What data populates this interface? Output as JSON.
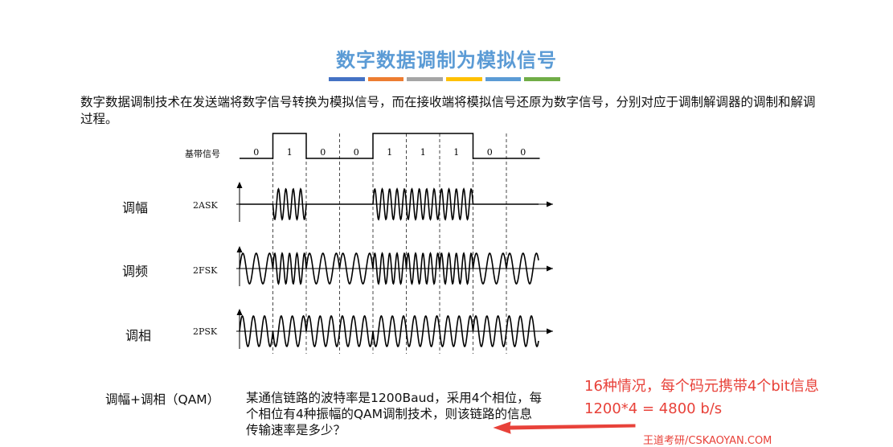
{
  "title": "数字数据调制为模拟信号",
  "title_bar_colors": [
    "#4472c4",
    "#ed7d31",
    "#a5a5a5",
    "#ffc000",
    "#5b9bd5",
    "#70ad47"
  ],
  "intro": "数字数据调制技术在发送端将数字信号转换为模拟信号，而在接收端将模拟信号还原为数字信号，分别对应于调制解调器的调制和解调过程。",
  "diagram": {
    "baseband_label": "基带信号",
    "bits": [
      "0",
      "1",
      "0",
      "0",
      "1",
      "1",
      "1",
      "0",
      "0"
    ],
    "rows": [
      {
        "label": "调幅",
        "signal": "2ASK"
      },
      {
        "label": "调频",
        "signal": "2FSK"
      },
      {
        "label": "调相",
        "signal": "2PSK"
      }
    ]
  },
  "qam_label": "调幅+调相（QAM）",
  "question": "某通信链路的波特率是1200Baud，采用4个相位，每个相位有4种振幅的QAM调制技术，则该链路的信息传输速率是多少？",
  "answer": {
    "line1": "16种情况，每个码元携带4个bit信息",
    "line2": "1200*4 = 4800 b/s"
  },
  "watermark": "王道考研/CSKAOYAN.COM",
  "accent_color": "#e8423a"
}
